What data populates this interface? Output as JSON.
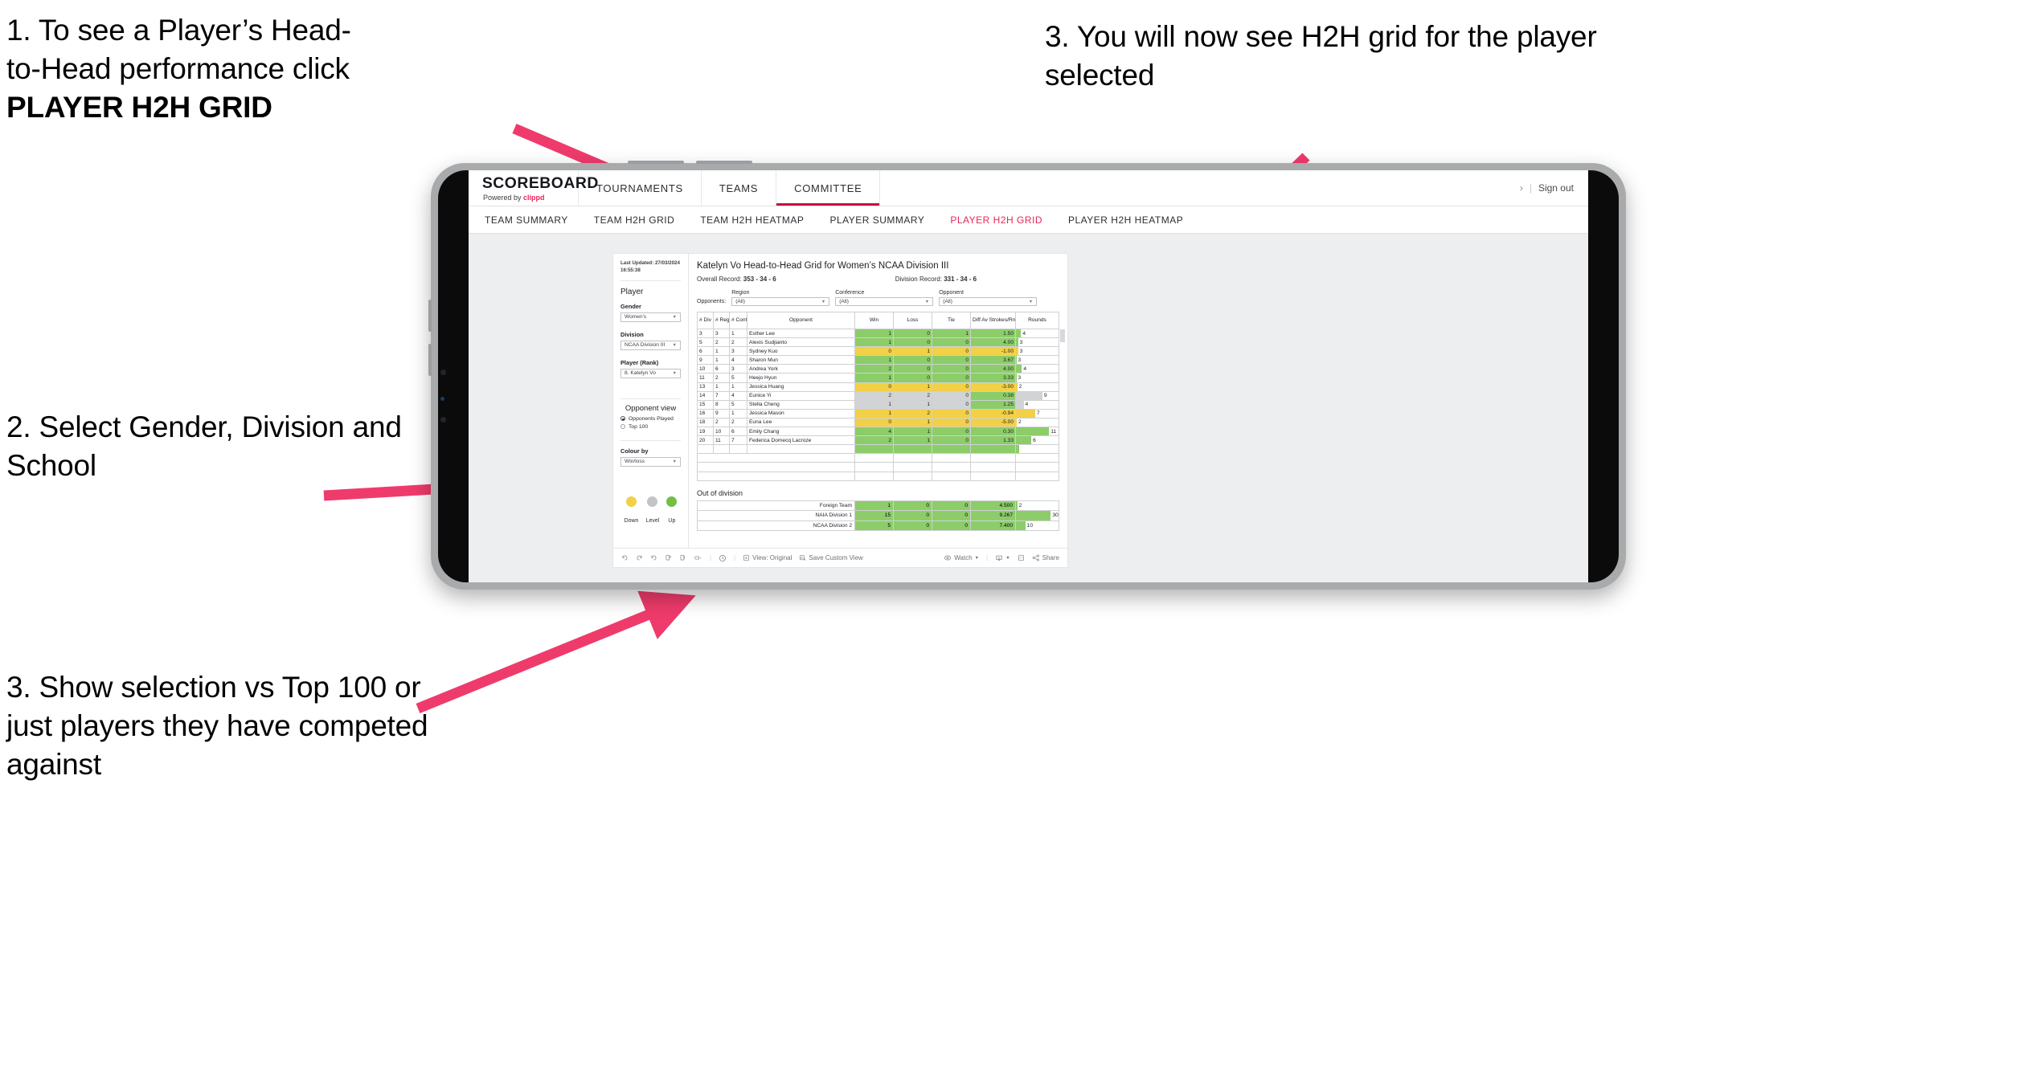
{
  "annotations": [
    {
      "id": "ann-1",
      "lines": [
        "1. To see a Player’s Head-",
        "to-Head performance click"
      ],
      "bold": "PLAYER H2H GRID"
    },
    {
      "id": "ann-2",
      "text": "2. Select Gender, Division and School"
    },
    {
      "id": "ann-3",
      "text": "3. Show selection vs Top 100 or just players they have competed against"
    },
    {
      "id": "ann-4",
      "text": "3. You will now see H2H grid for the player selected"
    }
  ],
  "colors": {
    "accent_pink": "#e8245b",
    "arrow_pink": "#ef3b6c",
    "win_green": "#8ccd6a",
    "loss_yellow": "#f2d047",
    "level_grey": "#d2d3d5",
    "device_frame": "#a8aaac",
    "app_bg": "#edeef0"
  },
  "app": {
    "brand": {
      "title": "SCOREBOARD",
      "powered_prefix": "Powered by ",
      "powered_name": "clippd"
    },
    "main_nav": [
      {
        "label": "TOURNAMENTS",
        "active": false
      },
      {
        "label": "TEAMS",
        "active": false
      },
      {
        "label": "COMMITTEE",
        "active": true
      }
    ],
    "top_right": {
      "chevron": "›",
      "separator": "|",
      "sign_out": "Sign out"
    },
    "sub_nav": [
      {
        "label": "TEAM SUMMARY",
        "active": false
      },
      {
        "label": "TEAM H2H GRID",
        "active": false
      },
      {
        "label": "TEAM H2H HEATMAP",
        "active": false
      },
      {
        "label": "PLAYER SUMMARY",
        "active": false
      },
      {
        "label": "PLAYER H2H GRID",
        "active": true
      },
      {
        "label": "PLAYER H2H HEATMAP",
        "active": false
      }
    ]
  },
  "pane": {
    "last_updated": "Last Updated: 27/03/2024 16:55:38",
    "section_player": "Player",
    "filters": [
      {
        "label": "Gender",
        "value": "Women's"
      },
      {
        "label": "Division",
        "value": "NCAA Division III"
      },
      {
        "label": "Player (Rank)",
        "value": "8. Katelyn Vo"
      }
    ],
    "opponent_view": {
      "heading": "Opponent view",
      "options": [
        {
          "label": "Opponents Played",
          "selected": true
        },
        {
          "label": "Top 100",
          "selected": false
        }
      ]
    },
    "colour_by": {
      "label": "Colour by",
      "value": "Win/loss"
    },
    "legend": [
      {
        "label": "Down",
        "color": "#f2d047"
      },
      {
        "label": "Level",
        "color": "#c2c4c7"
      },
      {
        "label": "Up",
        "color": "#72bf44"
      }
    ]
  },
  "content": {
    "title": "Katelyn Vo Head-to-Head Grid for Women’s NCAA Division III",
    "overall_record_label": "Overall Record: ",
    "overall_record_value": "353 -  34 - 6",
    "division_record_label": "Division Record: ",
    "division_record_value": "331 -  34 - 6",
    "opponents_label": "Opponents:",
    "opponent_filters": [
      {
        "label": "Region",
        "value": "(All)"
      },
      {
        "label": "Conference",
        "value": "(All)"
      },
      {
        "label": "Opponent",
        "value": "(All)"
      }
    ],
    "columns": [
      "# Div",
      "# Reg",
      "# Conf",
      "Opponent",
      "Win",
      "Loss",
      "Tie",
      "Diff Av Strokes/Rnd",
      "Rounds"
    ],
    "rows": [
      {
        "div": "3",
        "reg": "3",
        "conf": "1",
        "opponent": "Esther Lee",
        "win": "1",
        "loss": "0",
        "tie": "1",
        "diff": "1.50",
        "rounds": "4",
        "color": "green",
        "rounds_pct": 12
      },
      {
        "div": "5",
        "reg": "2",
        "conf": "2",
        "opponent": "Alexis Sudjianto",
        "win": "1",
        "loss": "0",
        "tie": "0",
        "diff": "4.00",
        "rounds": "3",
        "color": "green",
        "rounds_pct": 5
      },
      {
        "div": "6",
        "reg": "1",
        "conf": "3",
        "opponent": "Sydney Kuo",
        "win": "0",
        "loss": "1",
        "tie": "0",
        "diff": "-1.00",
        "rounds": "3",
        "color": "yellow",
        "rounds_pct": 5
      },
      {
        "div": "9",
        "reg": "1",
        "conf": "4",
        "opponent": "Sharon Mun",
        "win": "1",
        "loss": "0",
        "tie": "0",
        "diff": "3.67",
        "rounds": "3",
        "color": "green",
        "rounds_pct": 1
      },
      {
        "div": "10",
        "reg": "6",
        "conf": "3",
        "opponent": "Andrea York",
        "win": "2",
        "loss": "0",
        "tie": "0",
        "diff": "4.00",
        "rounds": "4",
        "color": "green",
        "rounds_pct": 14
      },
      {
        "div": "11",
        "reg": "2",
        "conf": "5",
        "opponent": "Heejo Hyun",
        "win": "1",
        "loss": "0",
        "tie": "0",
        "diff": "3.33",
        "rounds": "3",
        "color": "green",
        "rounds_pct": 1
      },
      {
        "div": "13",
        "reg": "1",
        "conf": "1",
        "opponent": "Jessica Huang",
        "win": "0",
        "loss": "1",
        "tie": "0",
        "diff": "-3.00",
        "rounds": "2",
        "color": "yellow",
        "rounds_pct": 3
      },
      {
        "div": "14",
        "reg": "7",
        "conf": "4",
        "opponent": "Eunice Yi",
        "win": "2",
        "loss": "2",
        "tie": "0",
        "diff": "0.38",
        "rounds": "9",
        "color": "grey",
        "rounds_pct": 62
      },
      {
        "div": "15",
        "reg": "8",
        "conf": "5",
        "opponent": "Stella Cheng",
        "win": "1",
        "loss": "1",
        "tie": "0",
        "diff": "1.25",
        "rounds": "4",
        "color": "grey",
        "rounds_pct": 18
      },
      {
        "div": "16",
        "reg": "9",
        "conf": "1",
        "opponent": "Jessica Mason",
        "win": "1",
        "loss": "2",
        "tie": "0",
        "diff": "-0.94",
        "rounds": "7",
        "color": "yellow",
        "rounds_pct": 45
      },
      {
        "div": "18",
        "reg": "2",
        "conf": "2",
        "opponent": "Euna Lee",
        "win": "0",
        "loss": "1",
        "tie": "0",
        "diff": "-5.00",
        "rounds": "2",
        "color": "yellow",
        "rounds_pct": 2
      },
      {
        "div": "19",
        "reg": "10",
        "conf": "6",
        "opponent": "Emily Chang",
        "win": "4",
        "loss": "1",
        "tie": "0",
        "diff": "0.30",
        "rounds": "11",
        "color": "green",
        "rounds_pct": 78
      },
      {
        "div": "20",
        "reg": "11",
        "conf": "7",
        "opponent": "Federica Domecq Lacroze",
        "win": "2",
        "loss": "1",
        "tie": "0",
        "diff": "1.33",
        "rounds": "6",
        "color": "green",
        "rounds_pct": 36
      }
    ],
    "out_of_division_heading": "Out of division",
    "out_of_division_rows": [
      {
        "label": "Foreign Team",
        "win": "1",
        "loss": "0",
        "tie": "0",
        "diff": "4.500",
        "rounds": "2",
        "color": "green",
        "rounds_pct": 3
      },
      {
        "label": "NAIA Division 1",
        "win": "15",
        "loss": "0",
        "tie": "0",
        "diff": "9.267",
        "rounds": "30",
        "color": "green",
        "rounds_pct": 82
      },
      {
        "label": "NCAA Division 2",
        "win": "5",
        "loss": "0",
        "tie": "0",
        "diff": "7.400",
        "rounds": "10",
        "color": "green",
        "rounds_pct": 22
      }
    ]
  },
  "toolbar": {
    "view_label": "View: Original",
    "save_label": "Save Custom View",
    "watch_label": "Watch",
    "share_label": "Share"
  }
}
